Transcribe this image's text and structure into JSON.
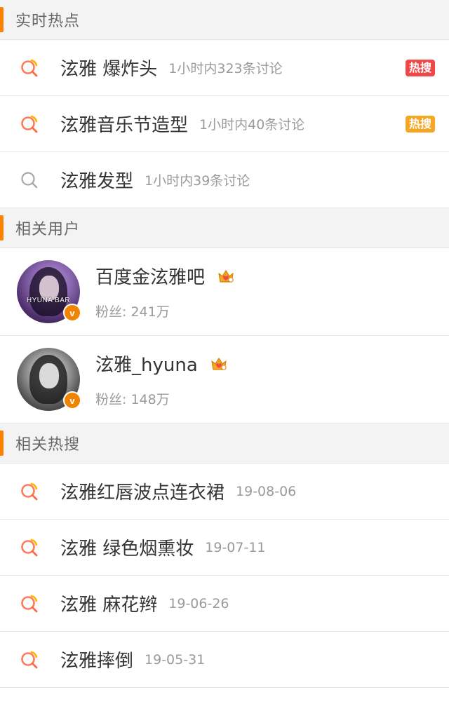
{
  "sections": {
    "realtime": {
      "title": "实时热点"
    },
    "users": {
      "title": "相关用户"
    },
    "related": {
      "title": "相关热搜"
    }
  },
  "realtime_items": [
    {
      "label": "泫雅 爆炸头",
      "meta": "1小时内323条讨论",
      "badge": "热搜",
      "badge_color": "#f04848",
      "icon": "search-hot-icon"
    },
    {
      "label": "泫雅音乐节造型",
      "meta": "1小时内40条讨论",
      "badge": "热搜",
      "badge_color": "#f5a623",
      "icon": "search-hot-icon"
    },
    {
      "label": "泫雅发型",
      "meta": "1小时内39条讨论",
      "icon": "search-icon"
    }
  ],
  "users": [
    {
      "name": "百度金泫雅吧",
      "followers": "粉丝: 241万",
      "avatar_text": "HYUNA BAR",
      "verified": "v"
    },
    {
      "name": "泫雅_hyuna",
      "followers": "粉丝: 148万",
      "verified": "v"
    }
  ],
  "related_items": [
    {
      "label": "泫雅红唇波点连衣裙",
      "meta": "19-08-06",
      "icon": "search-hot-icon"
    },
    {
      "label": "泫雅 绿色烟熏妆",
      "meta": "19-07-11",
      "icon": "search-hot-icon"
    },
    {
      "label": "泫雅 麻花辫",
      "meta": "19-06-26",
      "icon": "search-hot-icon"
    },
    {
      "label": "泫雅摔倒",
      "meta": "19-05-31",
      "icon": "search-hot-icon"
    }
  ],
  "colors": {
    "accent": "#ff8200",
    "hot_search_red": "#f04848",
    "hot_search_orange": "#f5a623",
    "text_primary": "#333333",
    "text_secondary": "#9a9a9a"
  }
}
